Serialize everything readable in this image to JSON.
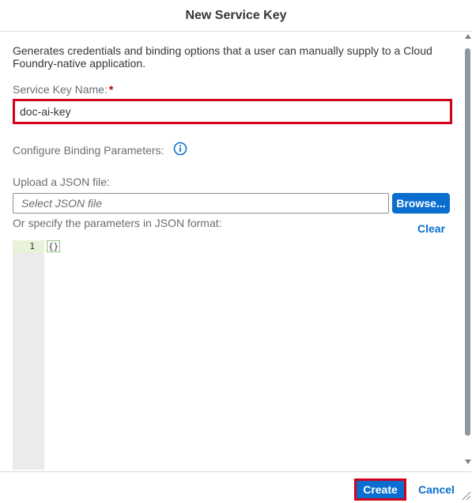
{
  "dialog": {
    "title": "New Service Key",
    "description": "Generates credentials and binding options that a user can manually supply to a Cloud Foundry-native application.",
    "service_key_name": {
      "label": "Service Key Name:",
      "required_marker": "*",
      "value": "doc-ai-key"
    },
    "binding_parameters_label": "Configure Binding Parameters:",
    "upload": {
      "label": "Upload a JSON file:",
      "placeholder": "Select JSON file",
      "browse_label": "Browse..."
    },
    "json_label": "Or specify the parameters in JSON format:",
    "clear_label": "Clear",
    "editor": {
      "line_number": "1",
      "code": "{}"
    },
    "footer": {
      "create_label": "Create",
      "cancel_label": "Cancel"
    }
  },
  "colors": {
    "accent": "#0a6ed1",
    "highlight_border": "#d3001c",
    "required": "#bb0000"
  },
  "icons": [
    "info-icon",
    "resize-handle-icon",
    "scroll-up-icon",
    "scroll-down-icon"
  ]
}
